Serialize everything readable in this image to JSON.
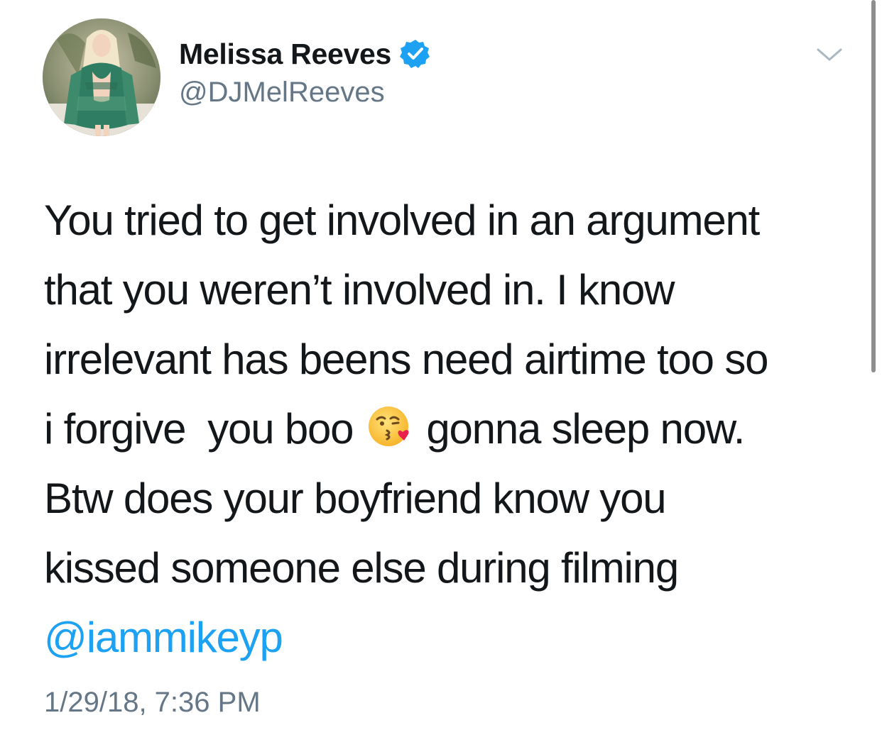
{
  "tweet": {
    "author": {
      "display_name": "Melissa Reeves",
      "handle": "@DJMelReeves",
      "verified": true
    },
    "body_lines": [
      "You tried to get involved in an argument",
      "that you weren’t involved in. I know",
      "irrelevant has beens need airtime too so"
    ],
    "line4": {
      "before_emoji": "i forgive  you boo",
      "emoji_name": "face-blowing-a-kiss-emoji",
      "after_emoji": "gonna sleep now."
    },
    "body_lines_end": [
      "Btw does your boyfriend know you",
      "kissed someone else during filming"
    ],
    "mention": "@iammikeyp",
    "timestamp": "1/29/18, 7:36 PM"
  },
  "icons": {
    "verified": "verified-badge-icon",
    "more": "chevron-down-icon"
  },
  "colors": {
    "text": "#14171a",
    "secondary": "#657786",
    "link": "#1da1f2",
    "verified": "#1da1f2"
  }
}
